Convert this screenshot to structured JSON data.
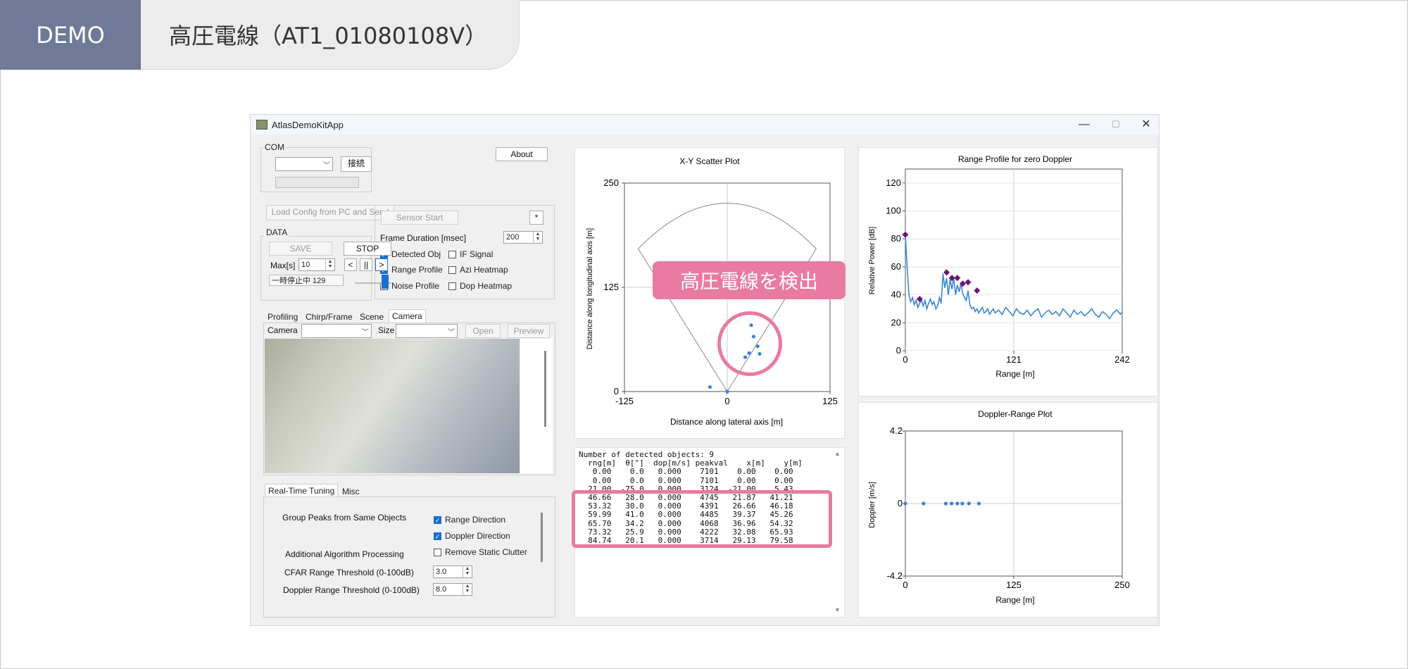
{
  "slide": {
    "demo_label": "DEMO",
    "title": "高圧電線（AT1_01080108V）",
    "callout": "高圧電線を検出"
  },
  "window": {
    "title": "AtlasDemoKitApp",
    "minimize": "—",
    "maximize": "☐",
    "close": "✕"
  },
  "com": {
    "group_label": "COM",
    "connect_label": "接続",
    "about_label": "About"
  },
  "controls": {
    "load_config_label": "Load Config from PC and Send",
    "sensor_start_label": "Sensor Start",
    "asterisk_label": "*",
    "frame_duration_label": "Frame Duration [msec]",
    "frame_duration_value": "200",
    "checkboxes": [
      {
        "label": "Detected Obj",
        "checked": true
      },
      {
        "label": "IF Signal",
        "checked": false
      },
      {
        "label": "Range Profile",
        "checked": true
      },
      {
        "label": "Azi Heatmap",
        "checked": false
      },
      {
        "label": "Noise Profile",
        "checked": false
      },
      {
        "label": "Dop Heatmap",
        "checked": false
      }
    ]
  },
  "data": {
    "group_label": "DATA",
    "save_label": "SAVE",
    "stop_label": "STOP",
    "max_label": "Max[s]",
    "max_value": "10",
    "prev_label": "<",
    "pause_label": "||",
    "next_label": ">",
    "status": "一時停止中 129"
  },
  "camera": {
    "tabs": [
      "Profiling",
      "Chirp/Frame",
      "Scene",
      "Camera"
    ],
    "active_tab": "Camera",
    "camera_label": "Camera",
    "size_label": "Size",
    "open_label": "Open",
    "preview_label": "Preview"
  },
  "tuning": {
    "tabs": [
      "Real-Time Tuning",
      "Misc"
    ],
    "group_peaks_label": "Group Peaks from Same Objects",
    "range_direction_label": "Range Direction",
    "range_direction_checked": true,
    "doppler_direction_label": "Doppler Direction",
    "doppler_direction_checked": true,
    "additional_label": "Additional Algorithm Processing",
    "remove_clutter_label": "Remove Static Clutter",
    "remove_clutter_checked": false,
    "cfar_label": "CFAR Range Threshold (0-100dB)",
    "cfar_value": "3.0",
    "doppler_threshold_label": "Doppler Range Threshold (0-100dB)",
    "doppler_threshold_value": "8.0"
  },
  "objects_text": "Number of detected objects: 9\n  rng[m]  θ[°]  dop[m/s] peakval    x[m]    y[m]\n   0.00    0.0   0.000    7101    0.00    0.00\n   0.00    0.0   0.000    7101    0.00    0.00\n  21.00  -75.0   0.000    3124  -21.00    5.43\n  46.66   28.0   0.000    4745   21.87   41.21\n  53.32   30.0   0.000    4391   26.66   46.18\n  59.99   41.0   0.000    4485   39.37   45.26\n  65.70   34.2   0.000    4068   36.96   54.32\n  73.32   25.9   0.000    4222   32.08   65.93\n  84.74   20.1   0.000    3714   29.13   79.58",
  "scatter_chart": {
    "type": "scatter",
    "title": "X-Y Scatter Plot",
    "xlabel": "Distance along lateral axis [m]",
    "ylabel": "Distance along longitudinal axis [m]",
    "xlim": [
      -125,
      125
    ],
    "ylim": [
      0,
      250
    ],
    "xticks": [
      "-125",
      "0",
      "125"
    ],
    "yticks": [
      "0",
      "125",
      "250"
    ],
    "x": [
      -21.0,
      0,
      21.87,
      26.66,
      39.37,
      36.96,
      32.08,
      29.13
    ],
    "y": [
      5.43,
      0,
      41.21,
      46.18,
      45.26,
      54.32,
      65.93,
      79.58
    ],
    "color": "#3b82d6"
  },
  "range_chart": {
    "type": "line",
    "title": "Range Profile for zero Doppler",
    "xlabel": "Range [m]",
    "ylabel": "Relative Power [dB]",
    "xlim": [
      0,
      242
    ],
    "ylim": [
      0,
      130
    ],
    "xticks": [
      "0",
      "121",
      "242"
    ],
    "yticks": [
      "0",
      "20",
      "40",
      "60",
      "80",
      "100",
      "120"
    ],
    "x": [
      0,
      2,
      4,
      6,
      8,
      10,
      12,
      14,
      16,
      18,
      20,
      22,
      24,
      26,
      28,
      30,
      32,
      34,
      36,
      38,
      40,
      42,
      44,
      46,
      48,
      50,
      52,
      54,
      56,
      58,
      60,
      62,
      64,
      66,
      68,
      70,
      72,
      74,
      76,
      78,
      80,
      82,
      84,
      86,
      88,
      90,
      92,
      94,
      96,
      98,
      100,
      104,
      108,
      112,
      116,
      120,
      124,
      128,
      132,
      136,
      140,
      144,
      148,
      152,
      156,
      160,
      164,
      168,
      172,
      176,
      180,
      184,
      188,
      192,
      196,
      200,
      204,
      208,
      212,
      216,
      220,
      224,
      228,
      232,
      236,
      240,
      242
    ],
    "values": [
      83,
      60,
      40,
      35,
      38,
      33,
      36,
      31,
      34,
      36,
      32,
      36,
      30,
      34,
      37,
      33,
      35,
      30,
      32,
      38,
      34,
      55,
      45,
      52,
      40,
      51,
      44,
      52,
      40,
      47,
      42,
      48,
      41,
      38,
      36,
      43,
      33,
      30,
      31,
      28,
      30,
      27,
      29,
      31,
      27,
      28,
      30,
      26,
      28,
      30,
      27,
      29,
      26,
      31,
      28,
      25,
      30,
      27,
      26,
      29,
      25,
      28,
      30,
      24,
      27,
      29,
      26,
      28,
      25,
      30,
      27,
      24,
      29,
      26,
      28,
      25,
      27,
      30,
      26,
      24,
      28,
      26,
      23,
      27,
      29,
      26,
      28
    ],
    "peaks_x": [
      0,
      16,
      46,
      52,
      58,
      64,
      70,
      80
    ],
    "peaks_y": [
      83,
      37,
      56,
      52,
      52,
      48,
      49,
      43
    ],
    "line_color": "#3a86d8",
    "peak_color": "#6b1577"
  },
  "doppler_chart": {
    "type": "scatter",
    "title": "Doppler-Range Plot",
    "xlabel": "Range [m]",
    "ylabel": "Doppler [m/s]",
    "xlim": [
      0,
      250
    ],
    "ylim": [
      -4.2,
      4.2
    ],
    "xticks": [
      "0",
      "125",
      "250"
    ],
    "yticks": [
      "-4.2",
      "0",
      "4.2"
    ],
    "x": [
      0,
      21.0,
      46.66,
      53.32,
      59.99,
      65.7,
      73.32,
      84.74
    ],
    "y": [
      0,
      0,
      0,
      0,
      0,
      0,
      0,
      0
    ],
    "color": "#3b82d6"
  },
  "colors": {
    "accent_pink": "#e97aa1",
    "demo_bg": "#6f7a99",
    "checkbox_blue": "#1a6fd1"
  }
}
